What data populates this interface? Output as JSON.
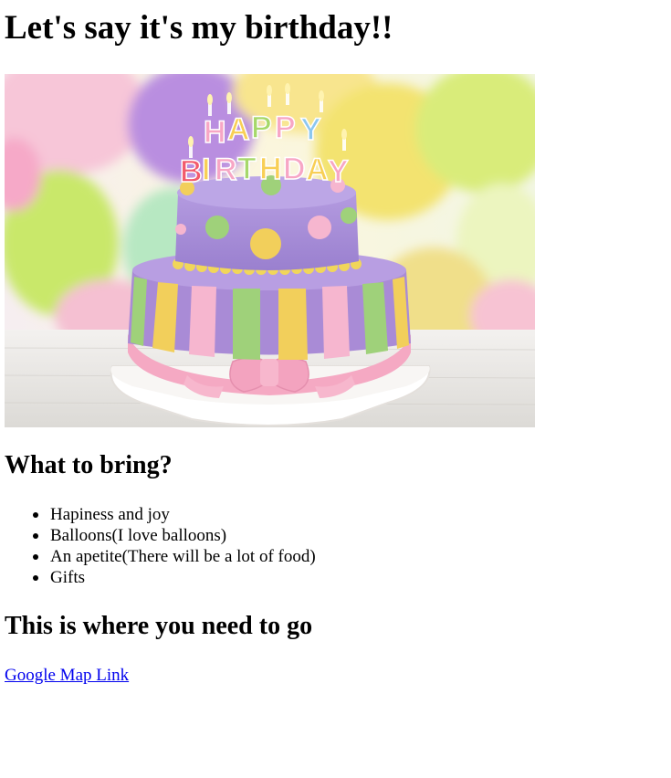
{
  "page": {
    "title": "Let's say it's my birthday!!"
  },
  "photo": {
    "alt": "birthday cake",
    "topper_letters": [
      "H",
      "A",
      "P",
      "P",
      "Y",
      "B",
      "I",
      "R",
      "T",
      "H",
      "D",
      "A",
      "Y"
    ],
    "colors": {
      "cake_top": "#a98bd6",
      "cake_stripe_yellow": "#f2cf5b",
      "cake_stripe_green": "#9fd17a",
      "cake_stripe_pink": "#f6b6cf",
      "ribbon_pink": "#f5a9c3",
      "board": "#ffffff"
    }
  },
  "bring_section": {
    "heading": "What to bring?",
    "items": [
      "Hapiness and joy",
      "Balloons(I love balloons)",
      "An apetite(There will be a lot of food)",
      "Gifts"
    ]
  },
  "location_section": {
    "heading": "This is where you need to go",
    "link_label": "Google Map Link",
    "link_color": "#0000ee"
  }
}
